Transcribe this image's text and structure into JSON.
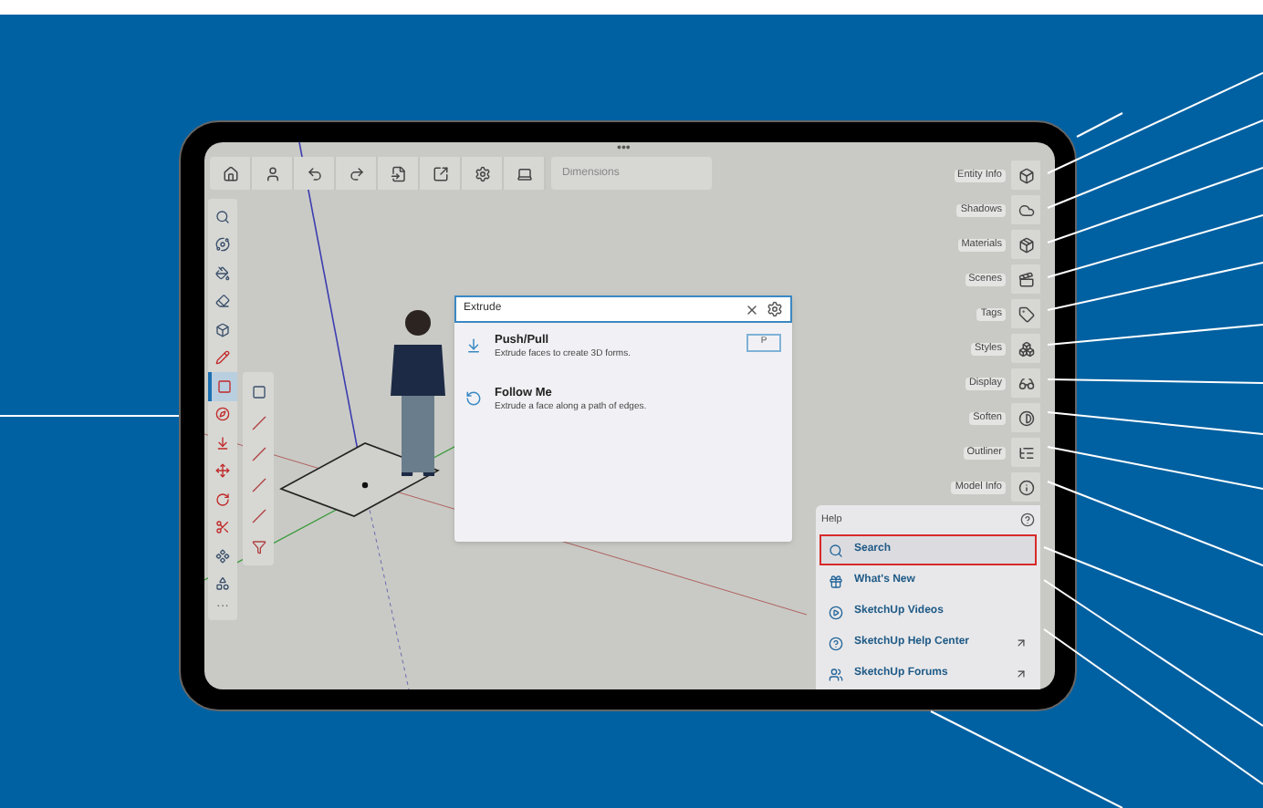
{
  "viewport": {
    "handle": "•••"
  },
  "top_toolbar": {
    "tools": [
      {
        "kind": "home"
      },
      {
        "kind": "profile"
      },
      {
        "kind": "undo"
      },
      {
        "kind": "redo"
      },
      {
        "kind": "import"
      },
      {
        "kind": "export"
      },
      {
        "kind": "settings"
      },
      {
        "kind": "display"
      }
    ],
    "dimensions_field": {
      "placeholder": "Dimensions"
    }
  },
  "left_toolbar": {
    "tools": [
      {
        "kind": "search",
        "selected": false
      },
      {
        "kind": "orbit",
        "selected": false
      },
      {
        "kind": "paint",
        "selected": false
      },
      {
        "kind": "eraser",
        "selected": false
      },
      {
        "kind": "box",
        "selected": false
      },
      {
        "kind": "pencil",
        "selected": false
      },
      {
        "kind": "rectangle",
        "selected": true
      },
      {
        "kind": "protractor",
        "selected": false
      },
      {
        "kind": "pushpull",
        "selected": false
      },
      {
        "kind": "move",
        "selected": false
      },
      {
        "kind": "rotate",
        "selected": false
      },
      {
        "kind": "section",
        "selected": false
      },
      {
        "kind": "component",
        "selected": false
      },
      {
        "kind": "shape",
        "selected": false
      }
    ],
    "more": "···"
  },
  "sub_toolbar": {
    "tools": [
      {
        "kind": "rectangle"
      },
      {
        "kind": "line"
      },
      {
        "kind": "line"
      },
      {
        "kind": "line"
      },
      {
        "kind": "line"
      },
      {
        "kind": "filter"
      }
    ]
  },
  "search_dialog": {
    "value": "Extrude",
    "results": [
      {
        "kind": "pushpull",
        "title": "Push/Pull",
        "description": "Extrude faces to create 3D forms.",
        "shortcut": "P"
      },
      {
        "kind": "followme",
        "title": "Follow Me",
        "description": "Extrude a face along a path of edges."
      }
    ]
  },
  "side_panel": {
    "items": [
      {
        "kind": "entity",
        "label": "Entity Info"
      },
      {
        "kind": "shadows",
        "label": "Shadows"
      },
      {
        "kind": "materials",
        "label": "Materials"
      },
      {
        "kind": "scenes",
        "label": "Scenes"
      },
      {
        "kind": "tags",
        "label": "Tags"
      },
      {
        "kind": "styles",
        "label": "Styles"
      },
      {
        "kind": "display",
        "label": "Display"
      },
      {
        "kind": "soften",
        "label": "Soften"
      },
      {
        "kind": "outliner",
        "label": "Outliner"
      },
      {
        "kind": "info",
        "label": "Model Info"
      }
    ]
  },
  "help_menu": {
    "title": "Help",
    "items": [
      {
        "kind": "search",
        "label": "Search",
        "selected": true,
        "external": false
      },
      {
        "kind": "whatsnew",
        "label": "What's New",
        "selected": false,
        "external": false
      },
      {
        "kind": "videos",
        "label": "SketchUp Videos",
        "selected": false,
        "external": false
      },
      {
        "kind": "helpcenter",
        "label": "SketchUp Help Center",
        "selected": false,
        "external": true
      },
      {
        "kind": "forums",
        "label": "SketchUp Forums",
        "selected": false,
        "external": true
      }
    ]
  }
}
